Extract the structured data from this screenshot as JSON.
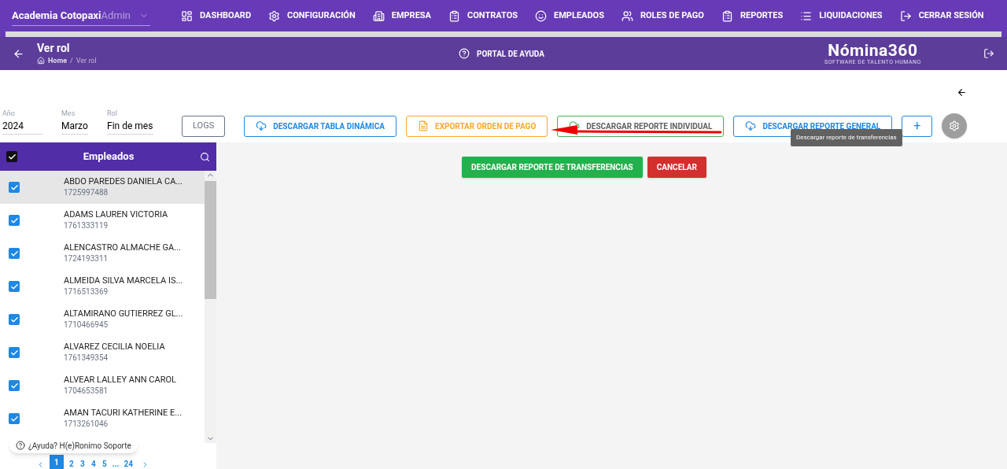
{
  "nav": {
    "company": "Academia Cotopaxi",
    "role": "Admin",
    "items": [
      {
        "label": "DASHBOARD"
      },
      {
        "label": "CONFIGURACIÓN"
      },
      {
        "label": "EMPRESA"
      },
      {
        "label": "CONTRATOS"
      },
      {
        "label": "EMPLEADOS"
      },
      {
        "label": "ROLES DE PAGO"
      },
      {
        "label": "REPORTES"
      },
      {
        "label": "LIQUIDACIONES"
      },
      {
        "label": "CERRAR SESIÓN"
      }
    ]
  },
  "header": {
    "title": "Ver rol",
    "breadcrumb": [
      "Home",
      "/",
      "Ver rol"
    ],
    "help": "PORTAL DE AYUDA",
    "logo": "Nómina360",
    "logo_tagline": "SOFTWARE DE TALENTO HUMANO"
  },
  "filters": [
    {
      "label": "Año",
      "value": "2024"
    },
    {
      "label": "Mes",
      "value": "Marzo"
    },
    {
      "label": "Rol",
      "value": "Fin de mes"
    }
  ],
  "toolbar": [
    {
      "kind": "logs",
      "label": "LOGS"
    },
    {
      "kind": "download",
      "label": "DESCARGAR TABLA DINÁMICA"
    },
    {
      "kind": "export",
      "label": "EXPORTAR ORDEN DE PAGO"
    },
    {
      "kind": "individual",
      "label": "DESCARGAR REPORTE INDIVIDUAL"
    },
    {
      "kind": "download",
      "label": "DESCARGAR REPORTE GENERAL"
    },
    {
      "kind": "add",
      "label": "+"
    }
  ],
  "tooltip": "Descargar reporte de transferencias",
  "employees": {
    "title": "Empleados",
    "all_checked": true,
    "rows": [
      {
        "name": "ABDO PAREDES DANIELA CA...",
        "id": "1725997488",
        "checked": true,
        "selected": true
      },
      {
        "name": "ADAMS LAUREN VICTORIA",
        "id": "1761333119",
        "checked": true,
        "selected": false
      },
      {
        "name": "ALENCASTRO ALMACHE GA...",
        "id": "1724193311",
        "checked": true,
        "selected": false
      },
      {
        "name": "ALMEIDA SILVA MARCELA IS...",
        "id": "1716513369",
        "checked": true,
        "selected": false
      },
      {
        "name": "ALTAMIRANO GUTIERREZ GL...",
        "id": "1710466945",
        "checked": true,
        "selected": false
      },
      {
        "name": "ALVAREZ CECILIA NOELIA",
        "id": "1761349354",
        "checked": true,
        "selected": false
      },
      {
        "name": "ALVEAR LALLEY ANN CAROL",
        "id": "1704653581",
        "checked": true,
        "selected": false
      },
      {
        "name": "AMAN TACURI KATHERINE E...",
        "id": "1713261046",
        "checked": true,
        "selected": false
      }
    ],
    "pages": [
      {
        "label": "1",
        "selected": true
      },
      {
        "label": "2",
        "selected": false
      },
      {
        "label": "3",
        "selected": false
      },
      {
        "label": "4",
        "selected": false
      },
      {
        "label": "5",
        "selected": false
      },
      {
        "label": "...",
        "selected": false
      },
      {
        "label": "24",
        "selected": false
      }
    ]
  },
  "actions": [
    {
      "kind": "green",
      "label": "DESCARGAR REPORTE DE TRANSFERENCIAS"
    },
    {
      "kind": "red",
      "label": "CANCELAR"
    }
  ],
  "help_chip": "¿Ayuda? H(e)Ronimo Soporte"
}
